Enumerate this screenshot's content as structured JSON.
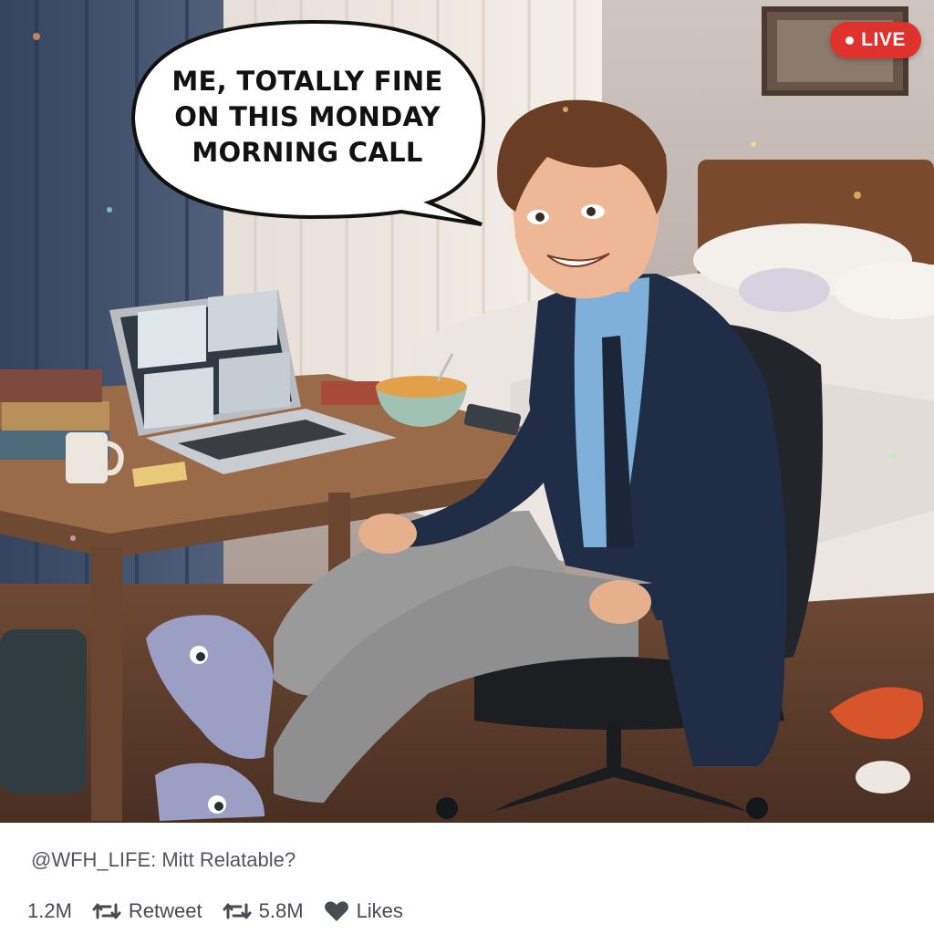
{
  "meme": {
    "speech_lines": [
      "ME, TOTALLY FINE",
      "ON THIS MONDAY",
      "MORNING CALL"
    ],
    "live_badge": "LIVE"
  },
  "post": {
    "caption": "@WFH_LIFE: Mitt Relatable?",
    "actions": {
      "count_1": "1.2M",
      "retweet_label": "Retweet",
      "count_2": "5.8M",
      "likes_label": "Likes"
    }
  },
  "colors": {
    "live_red": "#e0322c",
    "caption_gray": "#55565c",
    "action_gray": "#4a4b52"
  },
  "icons": [
    "retweet-icon",
    "retweet-icon",
    "heart-icon"
  ]
}
